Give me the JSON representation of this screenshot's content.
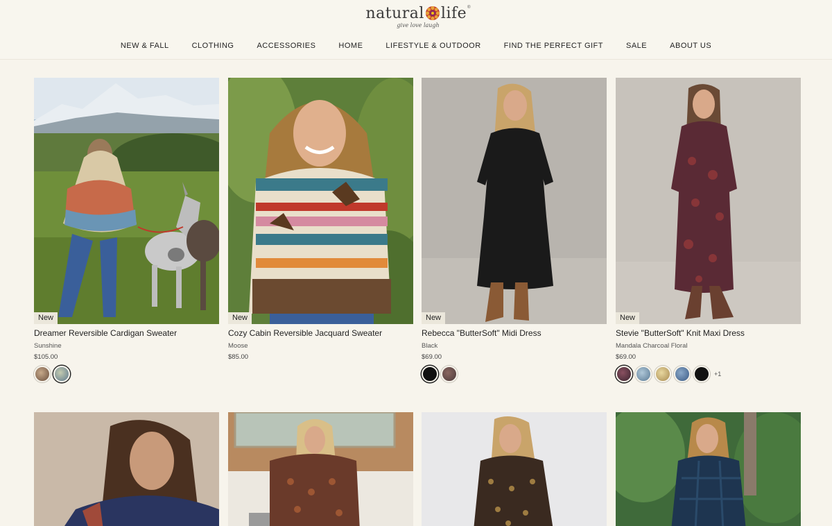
{
  "brand": {
    "name_left": "natural",
    "name_right": "life",
    "registered": "®",
    "tagline": "give love laugh"
  },
  "nav": [
    "NEW & FALL",
    "CLOTHING",
    "ACCESSORIES",
    "HOME",
    "LIFESTYLE & OUTDOOR",
    "FIND THE PERFECT GIFT",
    "SALE",
    "ABOUT US"
  ],
  "products": [
    {
      "badge": "New",
      "title": "Dreamer Reversible Cardigan Sweater",
      "variant": "Sunshine",
      "price": "$105.00",
      "swatch_colors": [
        "#8a6a55",
        "#6a8aa0"
      ],
      "more": ""
    },
    {
      "badge": "New",
      "title": "Cozy Cabin Reversible Jacquard Sweater",
      "variant": "Moose",
      "price": "$85.00",
      "swatch_colors": [],
      "more": ""
    },
    {
      "badge": "New",
      "title": "Rebecca \"ButterSoft\" Midi Dress",
      "variant": "Black",
      "price": "$69.00",
      "swatch_colors": [
        "#111111",
        "#6a4a48"
      ],
      "more": ""
    },
    {
      "badge": "New",
      "title": "Stevie \"ButterSoft\" Knit Maxi Dress",
      "variant": "Mandala Charcoal Floral",
      "price": "$69.00",
      "swatch_colors": [
        "#5a3a40",
        "#7a9ab0",
        "#c9b07a",
        "#5a7aa0",
        "#111111"
      ],
      "more": "+1"
    }
  ],
  "colors": {
    "background": "#f7f4ec",
    "badge_bg": "#ebe7db",
    "text": "#222222"
  }
}
